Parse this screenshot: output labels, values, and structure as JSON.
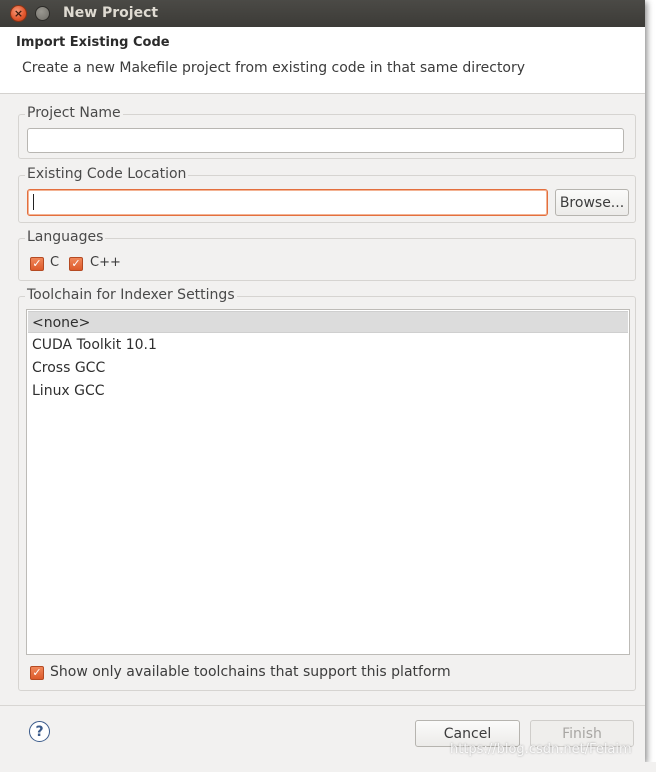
{
  "window": {
    "title": "New Project"
  },
  "header": {
    "title": "Import Existing Code",
    "description": "Create a new Makefile project from existing code in that same directory"
  },
  "project_name": {
    "label": "Project Name",
    "value": ""
  },
  "code_location": {
    "label": "Existing Code Location",
    "value": "",
    "browse_label": "Browse..."
  },
  "languages": {
    "label": "Languages",
    "options": [
      {
        "label": "C",
        "checked": true
      },
      {
        "label": "C++",
        "checked": true
      }
    ]
  },
  "toolchain": {
    "label": "Toolchain for Indexer Settings",
    "items": [
      {
        "label": "<none>",
        "selected": true
      },
      {
        "label": "CUDA Toolkit 10.1",
        "selected": false
      },
      {
        "label": "Cross GCC",
        "selected": false
      },
      {
        "label": "Linux GCC",
        "selected": false
      }
    ],
    "filter_label": "Show only available toolchains that support this platform",
    "filter_checked": true
  },
  "footer": {
    "cancel_label": "Cancel",
    "finish_label": "Finish"
  },
  "watermark": "https://blog.csdn.net/Felaim",
  "colors": {
    "accent": "#e0552c",
    "titlebar": "#3c3b37",
    "dialog_bg": "#f2f1f0"
  }
}
